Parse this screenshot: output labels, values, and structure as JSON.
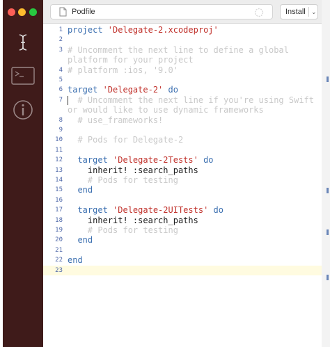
{
  "toolbar": {
    "filename": "Podfile",
    "install_label": "Install"
  },
  "sidebar": {
    "icons": [
      "text-cursor-icon",
      "terminal-icon",
      "info-icon"
    ]
  },
  "colors": {
    "sidebar_bg": "#3f1b1a",
    "keyword": "#3b6fb0",
    "string": "#c0302a",
    "comment": "#c9c9c9",
    "line_number": "#4d67a8",
    "current_line": "#fffbe0"
  },
  "editor": {
    "lines": [
      {
        "n": "1",
        "tokens": [
          {
            "t": "project ",
            "c": "kw"
          },
          {
            "t": "'Delegate-2.xcodeproj'",
            "c": "str"
          }
        ]
      },
      {
        "n": "2",
        "tokens": []
      },
      {
        "n": "3",
        "tokens": [
          {
            "t": "# Uncomment the next line to define a global",
            "c": "cm"
          }
        ]
      },
      {
        "n": "",
        "tokens": [
          {
            "t": "platform for your project",
            "c": "cm"
          }
        ]
      },
      {
        "n": "4",
        "tokens": [
          {
            "t": "# platform :ios, '9.0'",
            "c": "cm"
          }
        ]
      },
      {
        "n": "5",
        "tokens": []
      },
      {
        "n": "6",
        "tokens": [
          {
            "t": "target ",
            "c": "kw"
          },
          {
            "t": "'Delegate-2'",
            "c": "str"
          },
          {
            "t": " do",
            "c": "kw"
          }
        ]
      },
      {
        "n": "7",
        "tokens": [
          {
            "t": "  # Uncomment the next line if you're using Swift",
            "c": "cm"
          }
        ],
        "cursor": true
      },
      {
        "n": "",
        "tokens": [
          {
            "t": "or would like to use dynamic frameworks",
            "c": "cm"
          }
        ]
      },
      {
        "n": "8",
        "tokens": [
          {
            "t": "  # use_frameworks!",
            "c": "cm"
          }
        ]
      },
      {
        "n": "9",
        "tokens": []
      },
      {
        "n": "10",
        "tokens": [
          {
            "t": "  # Pods for Delegate-2",
            "c": "cm"
          }
        ]
      },
      {
        "n": "11",
        "tokens": []
      },
      {
        "n": "12",
        "tokens": [
          {
            "t": "  target ",
            "c": "kw"
          },
          {
            "t": "'Delegate-2Tests'",
            "c": "str"
          },
          {
            "t": " do",
            "c": "kw"
          }
        ]
      },
      {
        "n": "13",
        "tokens": [
          {
            "t": "    inherit! :search_paths",
            "c": "pl"
          }
        ]
      },
      {
        "n": "14",
        "tokens": [
          {
            "t": "    # Pods for testing",
            "c": "cm"
          }
        ]
      },
      {
        "n": "15",
        "tokens": [
          {
            "t": "  end",
            "c": "kw"
          }
        ]
      },
      {
        "n": "16",
        "tokens": []
      },
      {
        "n": "17",
        "tokens": [
          {
            "t": "  target ",
            "c": "kw"
          },
          {
            "t": "'Delegate-2UITests'",
            "c": "str"
          },
          {
            "t": " do",
            "c": "kw"
          }
        ]
      },
      {
        "n": "18",
        "tokens": [
          {
            "t": "    inherit! :search_paths",
            "c": "pl"
          }
        ]
      },
      {
        "n": "19",
        "tokens": [
          {
            "t": "    # Pods for testing",
            "c": "cm"
          }
        ]
      },
      {
        "n": "20",
        "tokens": [
          {
            "t": "  end",
            "c": "kw"
          }
        ]
      },
      {
        "n": "21",
        "tokens": []
      },
      {
        "n": "22",
        "tokens": [
          {
            "t": "end",
            "c": "kw"
          }
        ]
      },
      {
        "n": "23",
        "tokens": [],
        "current": true
      }
    ]
  }
}
